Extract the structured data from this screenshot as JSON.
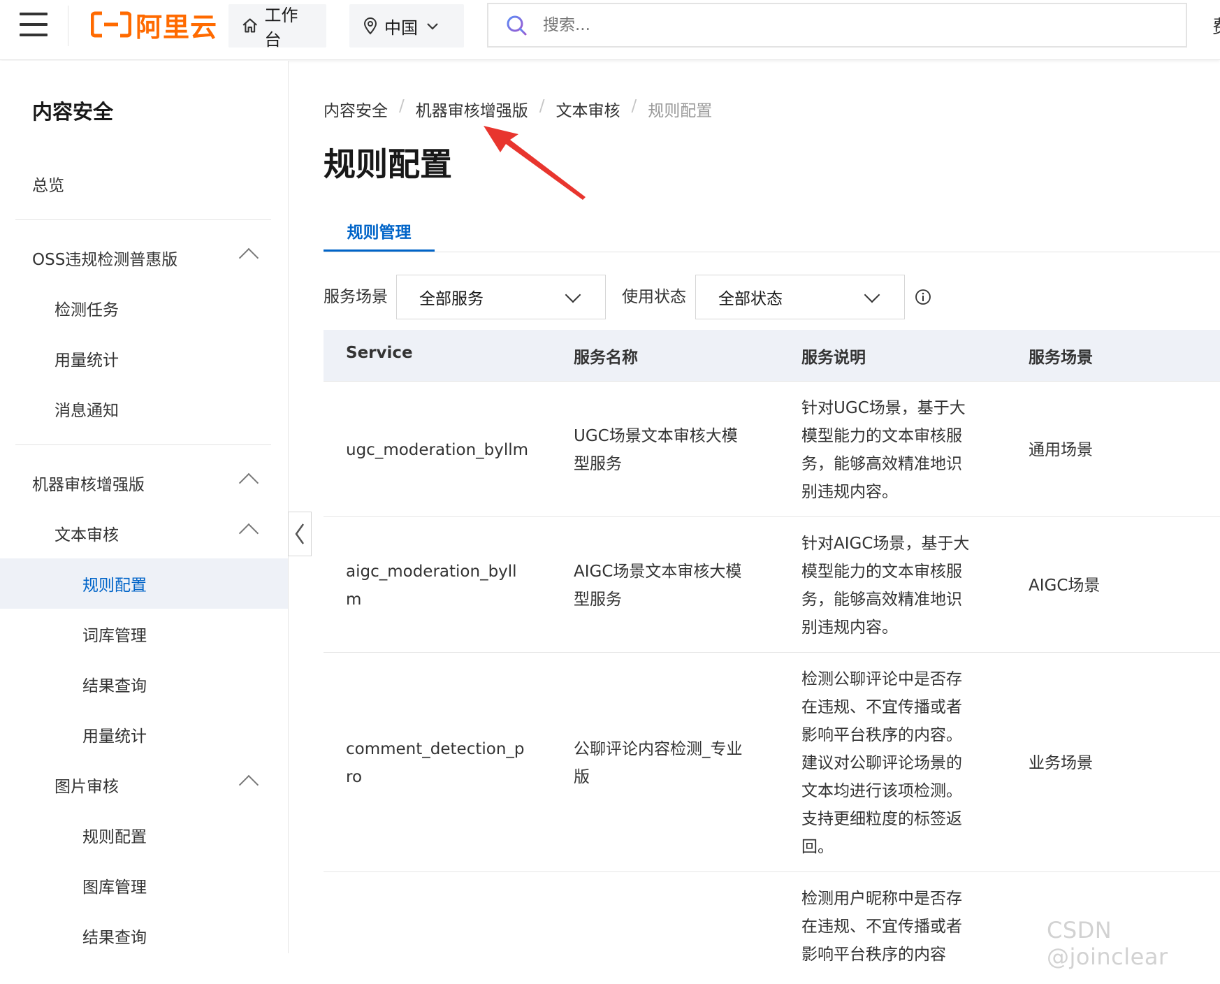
{
  "topbar": {
    "logo_text": "阿里云",
    "workbench_label": "工作台",
    "region_label": "中国",
    "search_placeholder": "搜索...",
    "cut_text": "费"
  },
  "sidebar": {
    "title": "内容安全",
    "items": [
      {
        "label": "总览",
        "level": 0
      },
      {
        "label": "OSS违规检测普惠版",
        "level": 0,
        "expanded": true
      },
      {
        "label": "检测任务",
        "level": 1
      },
      {
        "label": "用量统计",
        "level": 1
      },
      {
        "label": "消息通知",
        "level": 1
      },
      {
        "label": "机器审核增强版",
        "level": 0,
        "expanded": true
      },
      {
        "label": "文本审核",
        "level": 1,
        "expanded": true
      },
      {
        "label": "规则配置",
        "level": 2,
        "active": true
      },
      {
        "label": "词库管理",
        "level": 2
      },
      {
        "label": "结果查询",
        "level": 2
      },
      {
        "label": "用量统计",
        "level": 2
      },
      {
        "label": "图片审核",
        "level": 1,
        "expanded": true
      },
      {
        "label": "规则配置",
        "level": 2
      },
      {
        "label": "图库管理",
        "level": 2
      },
      {
        "label": "结果查询",
        "level": 2
      }
    ]
  },
  "breadcrumb": [
    "内容安全",
    "机器审核增强版",
    "文本审核",
    "规则配置"
  ],
  "page_title": "规则配置",
  "tabs": [
    {
      "label": "规则管理",
      "active": true
    }
  ],
  "filters": {
    "scene_label": "服务场景",
    "scene_value": "全部服务",
    "status_label": "使用状态",
    "status_value": "全部状态"
  },
  "table": {
    "headers": [
      "Service",
      "服务名称",
      "服务说明",
      "服务场景"
    ],
    "rows": [
      {
        "service": [
          "ugc_moderation_byllm"
        ],
        "name": [
          "UGC场景文本审核大模",
          "型服务"
        ],
        "desc": [
          "针对UGC场景，基于大",
          "模型能力的文本审核服",
          "务，能够高效精准地识",
          "别违规内容。"
        ],
        "scene": "通用场景"
      },
      {
        "service": [
          "aigc_moderation_byll",
          "m"
        ],
        "name": [
          "AIGC场景文本审核大模",
          "型服务"
        ],
        "desc": [
          "针对AIGC场景，基于大",
          "模型能力的文本审核服",
          "务，能够高效精准地识",
          "别违规内容。"
        ],
        "scene": "AIGC场景"
      },
      {
        "service": [
          "comment_detection_p",
          "ro"
        ],
        "name": [
          "公聊评论内容检测_专业",
          "版"
        ],
        "desc": [
          "检测公聊评论中是否存",
          "在违规、不宜传播或者",
          "影响平台秩序的内容。",
          "建议对公聊评论场景的",
          "文本均进行该项检测。",
          "支持更细粒度的标签返",
          "回。"
        ],
        "scene": "业务场景"
      },
      {
        "service": [],
        "name": [],
        "desc": [
          "检测用户昵称中是否存",
          "在违规、不宜传播或者",
          "影响平台秩序的内容"
        ],
        "scene": ""
      }
    ]
  },
  "watermark": "CSDN @joinclear",
  "colors": {
    "brand": "#ff6a00",
    "primary": "#0064c8",
    "annotation_arrow": "#e8352e",
    "active_bg": "#eef1f7"
  },
  "icons": [
    "hamburger-icon",
    "home-icon",
    "location-icon",
    "chevron-down-icon",
    "search-icon",
    "chevron-up-icon",
    "chevron-left-icon",
    "info-icon"
  ]
}
